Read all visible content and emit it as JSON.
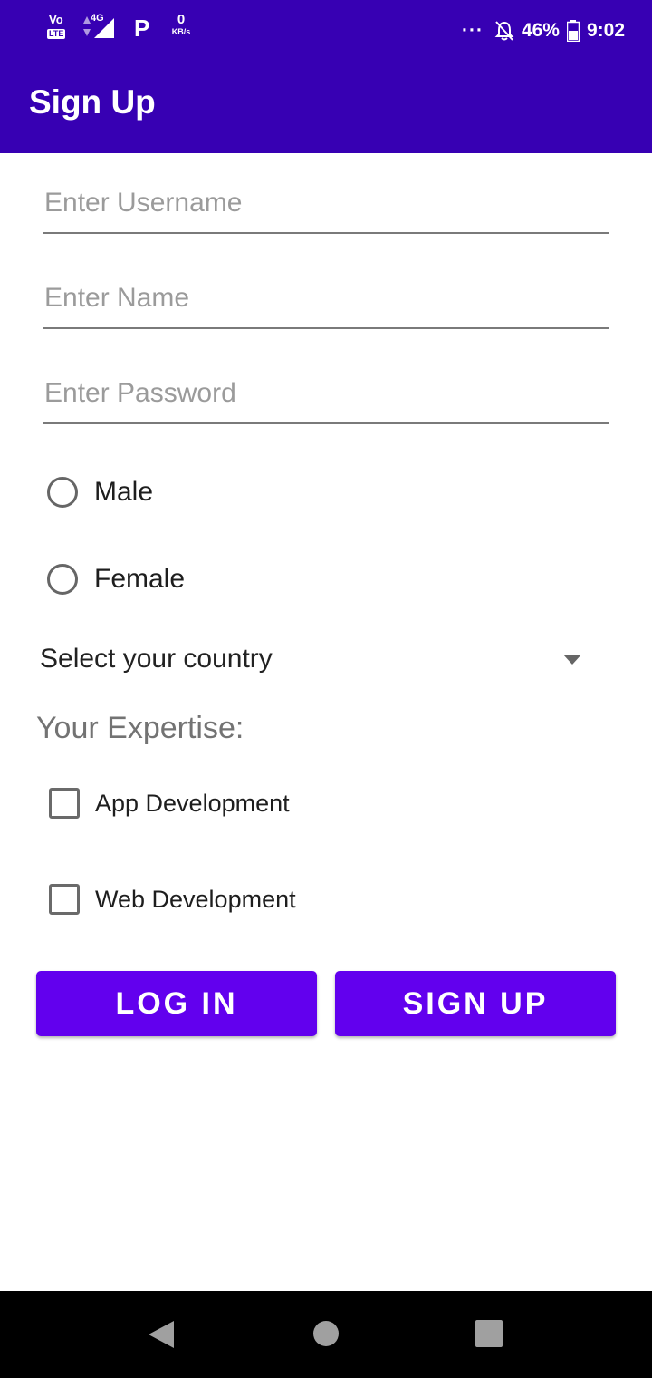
{
  "status_bar": {
    "volte": "Vo",
    "lte": "LTE",
    "network": "4G",
    "app_badge": "P",
    "speed_value": "0",
    "speed_unit": "KB/s",
    "more": "···",
    "battery_percent": "46%",
    "time": "9:02"
  },
  "toolbar": {
    "title": "Sign Up"
  },
  "form": {
    "username_placeholder": "Enter Username",
    "name_placeholder": "Enter Name",
    "password_placeholder": "Enter Password",
    "gender_options": [
      "Male",
      "Female"
    ],
    "country_spinner": "Select your country",
    "expertise_label": "Your Expertise:",
    "expertise_options": [
      "App Development",
      "Web Development"
    ]
  },
  "buttons": {
    "login": "LOG IN",
    "signup": "SIGN UP"
  },
  "colors": {
    "primary_dark": "#3700b3",
    "primary": "#6200ee",
    "nav_bar": "#000000"
  },
  "icons": {
    "signal": "signal-icon",
    "mute": "bell-off-icon",
    "battery": "battery-icon",
    "dropdown": "dropdown-arrow-icon",
    "back": "back-icon",
    "home": "home-icon",
    "recents": "recents-icon"
  }
}
